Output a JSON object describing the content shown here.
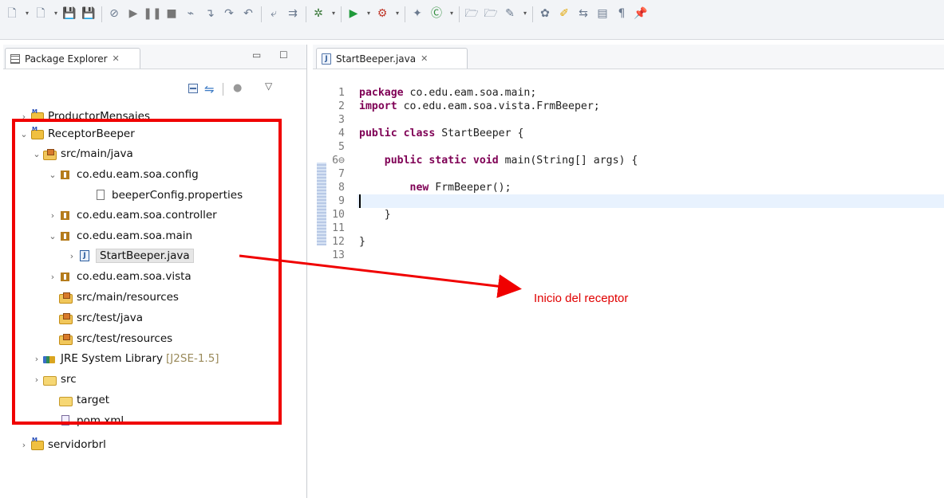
{
  "toolbar": {
    "icons": [
      "new-icon",
      "dropdown-icon",
      "new-wizard-icon",
      "dropdown-icon",
      "save-icon",
      "save-all-icon",
      "skip-breakpoints-icon",
      "resume-icon",
      "suspend-icon",
      "terminate-icon",
      "disconnect-icon",
      "step-into-icon",
      "step-over-icon",
      "step-return-icon",
      "drop-to-frame-icon",
      "use-step-filters-icon",
      "debug-icon",
      "dropdown-icon",
      "run-icon",
      "dropdown-icon",
      "external-tools-icon",
      "dropdown-icon",
      "new-java-project-icon",
      "new-java-class-icon",
      "dropdown-icon",
      "open-type-icon",
      "open-task-icon",
      "search-icon",
      "dropdown-icon",
      "toggle-mark-occurrences-icon",
      "toggle-breadcrumb-icon",
      "word-wrap-icon",
      "block-selection-icon",
      "show-whitespace-icon",
      "pin-editor-icon"
    ]
  },
  "explorer": {
    "title": "Package Explorer",
    "close_glyph": "✕",
    "tree": [
      {
        "label": "ProductorMensajes",
        "icon": "project-icon",
        "arrow": ">"
      },
      {
        "label": "ReceptorBeeper",
        "icon": "project-icon",
        "arrow": "v"
      },
      {
        "label": "src/main/java",
        "icon": "source-folder-icon",
        "arrow": "v"
      },
      {
        "label": "co.edu.eam.soa.config",
        "icon": "package-icon",
        "arrow": "v"
      },
      {
        "label": "beeperConfig.properties",
        "icon": "properties-file-icon",
        "arrow": ""
      },
      {
        "label": "co.edu.eam.soa.controller",
        "icon": "package-icon",
        "arrow": ">"
      },
      {
        "label": "co.edu.eam.soa.main",
        "icon": "package-icon",
        "arrow": "v"
      },
      {
        "label": "StartBeeper.java",
        "icon": "java-file-icon",
        "arrow": ">"
      },
      {
        "label": "co.edu.eam.soa.vista",
        "icon": "package-icon",
        "arrow": ">"
      },
      {
        "label": "src/main/resources",
        "icon": "source-folder-icon",
        "arrow": ""
      },
      {
        "label": "src/test/java",
        "icon": "source-folder-icon",
        "arrow": ""
      },
      {
        "label": "src/test/resources",
        "icon": "source-folder-icon",
        "arrow": ""
      },
      {
        "label": "JRE System Library",
        "suffix": "[J2SE-1.5]",
        "icon": "library-icon",
        "arrow": ">"
      },
      {
        "label": "src",
        "icon": "folder-icon",
        "arrow": ">"
      },
      {
        "label": "target",
        "icon": "folder-icon",
        "arrow": ""
      },
      {
        "label": "pom.xml",
        "icon": "xml-file-icon",
        "arrow": ""
      },
      {
        "label": "servidorbrl",
        "icon": "project-icon",
        "arrow": ">"
      }
    ]
  },
  "editor": {
    "tab_label": "StartBeeper.java",
    "tab_close": "✕",
    "lines": [
      {
        "n": "1",
        "kw": "package",
        "rest": " co.edu.eam.soa.main;"
      },
      {
        "n": "2",
        "kw": "import",
        "rest": " co.edu.eam.soa.vista.FrmBeeper;"
      },
      {
        "n": "3",
        "kw": "",
        "rest": ""
      },
      {
        "n": "4",
        "kw": "public class",
        "rest": " StartBeeper {"
      },
      {
        "n": "5",
        "kw": "",
        "rest": ""
      },
      {
        "n": "6⊖",
        "kw": "    public static void",
        "rest": " main(String[] args) {"
      },
      {
        "n": "7",
        "kw": "",
        "rest": ""
      },
      {
        "n": "8",
        "kw": "        new",
        "rest": " FrmBeeper();"
      },
      {
        "n": "9",
        "kw": "",
        "rest": ""
      },
      {
        "n": "10",
        "kw": "",
        "rest": "    }"
      },
      {
        "n": "11",
        "kw": "",
        "rest": ""
      },
      {
        "n": "12",
        "kw": "",
        "rest": "}"
      },
      {
        "n": "13",
        "kw": "",
        "rest": ""
      }
    ]
  },
  "annotation": {
    "text": "Inicio del receptor",
    "color": "#e00000"
  },
  "colors": {
    "keyword": "#7f0055",
    "current_line": "#e8f2fe",
    "highlight_box": "#f00000"
  }
}
